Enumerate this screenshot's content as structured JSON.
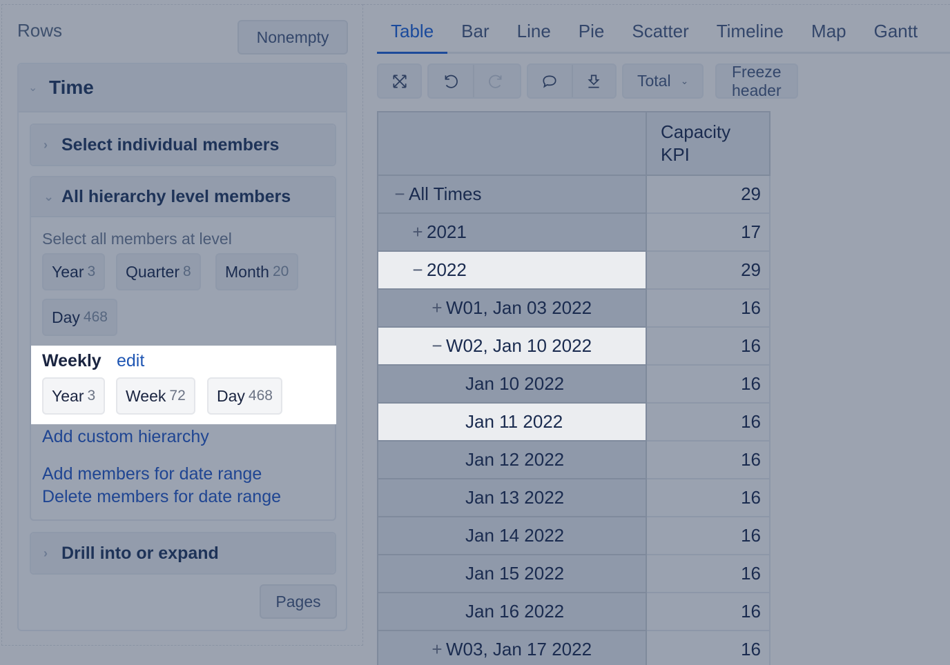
{
  "rows_panel": {
    "title": "Rows",
    "nonempty_label": "Nonempty",
    "dimension": "Time",
    "select_individual_label": "Select individual members",
    "all_hierarchy_label": "All hierarchy level members",
    "select_all_label": "Select all members at level",
    "default_levels": [
      {
        "name": "Year",
        "count": "3"
      },
      {
        "name": "Quarter",
        "count": "8"
      },
      {
        "name": "Month",
        "count": "20"
      },
      {
        "name": "Day",
        "count": "468"
      }
    ],
    "custom_hierarchy": {
      "name": "Weekly",
      "edit_label": "edit",
      "levels": [
        {
          "name": "Year",
          "count": "3"
        },
        {
          "name": "Week",
          "count": "72"
        },
        {
          "name": "Day",
          "count": "468"
        }
      ]
    },
    "add_custom_hierarchy_label": "Add custom hierarchy",
    "add_date_range_label": "Add members for date range",
    "delete_date_range_label": "Delete members for date range",
    "drill_label": "Drill into or expand",
    "pages_label": "Pages"
  },
  "tabs": [
    {
      "label": "Table",
      "active": true
    },
    {
      "label": "Bar",
      "active": false
    },
    {
      "label": "Line",
      "active": false
    },
    {
      "label": "Pie",
      "active": false
    },
    {
      "label": "Scatter",
      "active": false
    },
    {
      "label": "Timeline",
      "active": false
    },
    {
      "label": "Map",
      "active": false
    },
    {
      "label": "Gantt",
      "active": false
    }
  ],
  "toolbar": {
    "icons": [
      "fullscreen-icon",
      "undo-icon",
      "redo-icon",
      "comment-icon",
      "download-icon"
    ],
    "total_label": "Total",
    "freeze_label": "Freeze header"
  },
  "table": {
    "measure_header_line1": "Capacity",
    "measure_header_line2": "KPI",
    "rows": [
      {
        "toggle": "−",
        "label": "All Times",
        "value": "29",
        "level": 0,
        "highlight": false
      },
      {
        "toggle": "+",
        "label": "2021",
        "value": "17",
        "level": 1,
        "highlight": false
      },
      {
        "toggle": "−",
        "label": "2022",
        "value": "29",
        "level": 1,
        "highlight": true
      },
      {
        "toggle": "+",
        "label": "W01, Jan 03 2022",
        "value": "16",
        "level": 2,
        "highlight": false
      },
      {
        "toggle": "−",
        "label": "W02, Jan 10 2022",
        "value": "16",
        "level": 2,
        "highlight": true
      },
      {
        "toggle": "",
        "label": "Jan 10 2022",
        "value": "16",
        "level": 3,
        "highlight": false
      },
      {
        "toggle": "",
        "label": "Jan 11 2022",
        "value": "16",
        "level": 3,
        "highlight": true
      },
      {
        "toggle": "",
        "label": "Jan 12 2022",
        "value": "16",
        "level": 3,
        "highlight": false
      },
      {
        "toggle": "",
        "label": "Jan 13 2022",
        "value": "16",
        "level": 3,
        "highlight": false
      },
      {
        "toggle": "",
        "label": "Jan 14 2022",
        "value": "16",
        "level": 3,
        "highlight": false
      },
      {
        "toggle": "",
        "label": "Jan 15 2022",
        "value": "16",
        "level": 3,
        "highlight": false
      },
      {
        "toggle": "",
        "label": "Jan 16 2022",
        "value": "16",
        "level": 3,
        "highlight": false
      },
      {
        "toggle": "+",
        "label": "W03, Jan 17 2022",
        "value": "16",
        "level": 2,
        "highlight": false
      }
    ]
  }
}
